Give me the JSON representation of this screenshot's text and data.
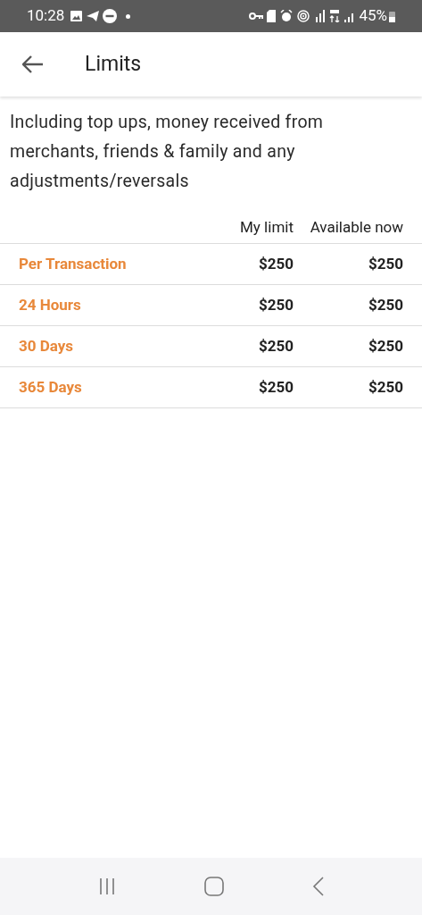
{
  "status_bar": {
    "time": "10:28",
    "battery": "45%"
  },
  "app_bar": {
    "title": "Limits"
  },
  "description": "Including top ups, money received from merchants, friends & family and any adjustments/reversals",
  "table": {
    "columns": [
      "My limit",
      "Available now"
    ],
    "rows": [
      {
        "label": "Per Transaction",
        "my_limit": "$250",
        "available_now": "$250"
      },
      {
        "label": "24 Hours",
        "my_limit": "$250",
        "available_now": "$250"
      },
      {
        "label": "30 Days",
        "my_limit": "$250",
        "available_now": "$250"
      },
      {
        "label": "365 Days",
        "my_limit": "$250",
        "available_now": "$250"
      }
    ]
  }
}
